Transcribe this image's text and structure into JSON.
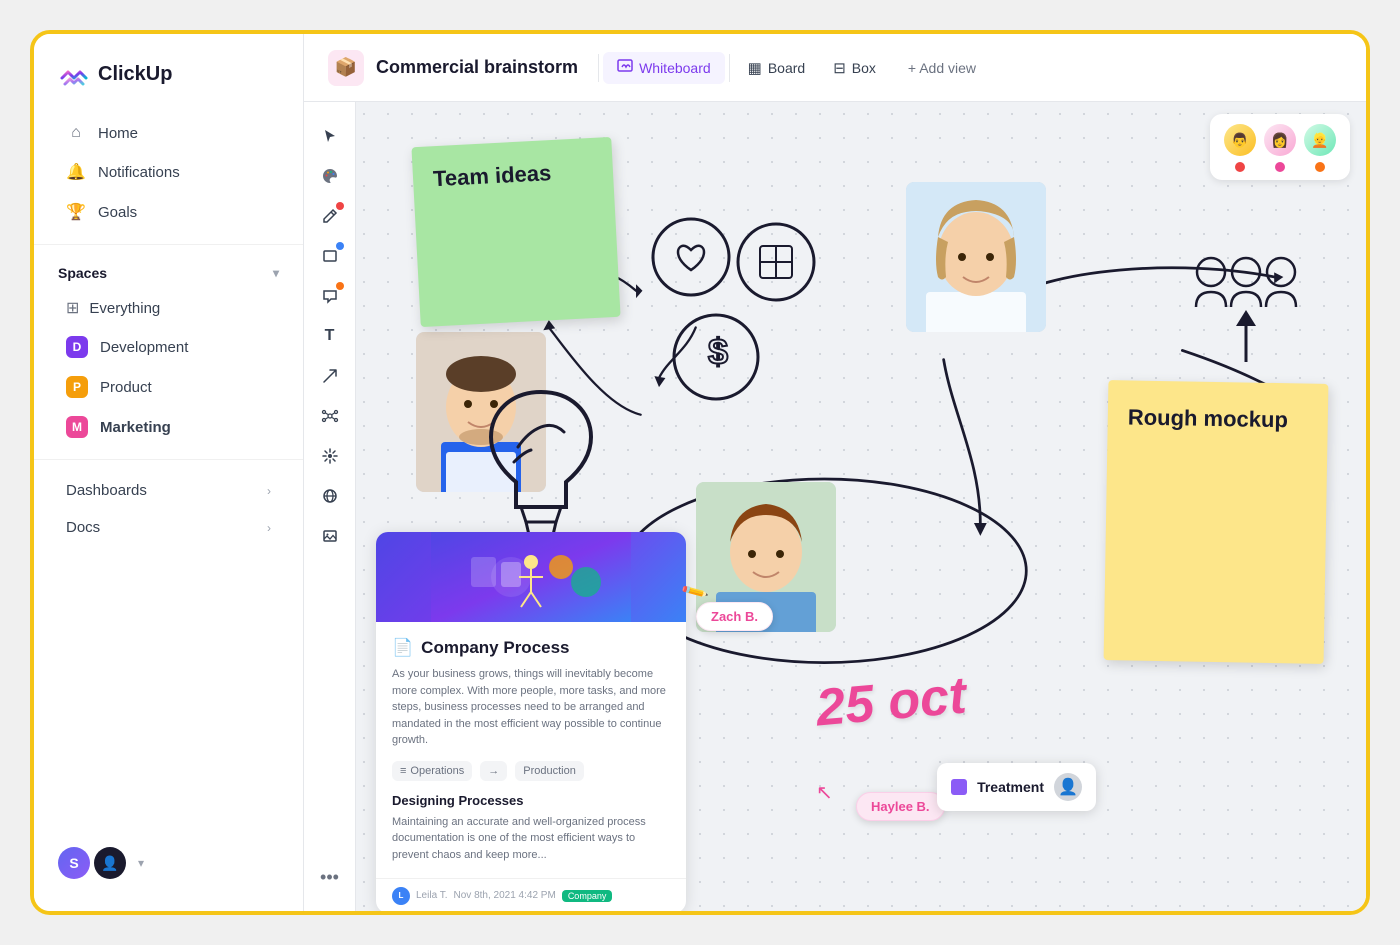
{
  "app": {
    "name": "ClickUp"
  },
  "sidebar": {
    "nav": [
      {
        "id": "home",
        "label": "Home",
        "icon": "🏠"
      },
      {
        "id": "notifications",
        "label": "Notifications",
        "icon": "🔔"
      },
      {
        "id": "goals",
        "label": "Goals",
        "icon": "🏆"
      }
    ],
    "spaces_label": "Spaces",
    "spaces": [
      {
        "id": "everything",
        "label": "Everything",
        "icon": "⊞"
      },
      {
        "id": "development",
        "label": "Development",
        "badge": "D",
        "color": "badge-d"
      },
      {
        "id": "product",
        "label": "Product",
        "badge": "P",
        "color": "badge-p"
      },
      {
        "id": "marketing",
        "label": "Marketing",
        "badge": "M",
        "color": "badge-m",
        "bold": true
      }
    ],
    "dashboards_label": "Dashboards",
    "docs_label": "Docs"
  },
  "header": {
    "doc_icon": "📦",
    "doc_title": "Commercial brainstorm",
    "tabs": [
      {
        "id": "whiteboard",
        "label": "Whiteboard",
        "icon": "✏️",
        "active": true
      },
      {
        "id": "board",
        "label": "Board",
        "icon": "⊞",
        "active": false
      },
      {
        "id": "box",
        "label": "Box",
        "icon": "⊟",
        "active": false
      }
    ],
    "add_view_label": "+ Add view"
  },
  "toolbar": {
    "tools": [
      {
        "id": "cursor",
        "icon": "↖",
        "dot": null
      },
      {
        "id": "palette",
        "icon": "🎨",
        "dot": null
      },
      {
        "id": "pencil",
        "icon": "✏️",
        "dot": "red"
      },
      {
        "id": "rectangle",
        "icon": "▭",
        "dot": "blue"
      },
      {
        "id": "comment",
        "icon": "💬",
        "dot": "orange"
      },
      {
        "id": "text",
        "icon": "T",
        "dot": null
      },
      {
        "id": "arrows",
        "icon": "↗",
        "dot": null
      },
      {
        "id": "network",
        "icon": "⑃",
        "dot": null
      },
      {
        "id": "sparkle",
        "icon": "✦",
        "dot": null
      },
      {
        "id": "globe",
        "icon": "🌐",
        "dot": null
      },
      {
        "id": "image",
        "icon": "🖼",
        "dot": null
      }
    ]
  },
  "canvas": {
    "sticky_green": {
      "text": "Team ideas"
    },
    "sticky_yellow": {
      "text": "Rough mockup"
    },
    "doc_card": {
      "title": "Company Process",
      "body": "As your business grows, things will inevitably become more complex. With more people, more tasks, and more steps, business processes need to be arranged and mandated in the most efficient way possible to continue growth.",
      "tags": [
        {
          "icon": "≡",
          "text": "Operations"
        },
        {
          "icon": "→",
          "text": "Production"
        }
      ],
      "subtitle": "Designing Processes",
      "body2": "Maintaining an accurate and well-organized process documentation is one of the most efficient ways to prevent chaos and keep more...",
      "footer_name": "Leila T.",
      "footer_date": "Nov 8th, 2021  4:42 PM",
      "footer_badge": "Company"
    },
    "name_labels": [
      {
        "text": "Zach B.",
        "class": "name-label-zach"
      },
      {
        "text": "Haylee B.",
        "class": "name-label-haylee"
      }
    ],
    "treatment_badge": {
      "label": "Treatment"
    },
    "handwritten_date": "25 oct",
    "collaborators": [
      {
        "initials": "👨",
        "dot": "dot-red"
      },
      {
        "initials": "👩",
        "dot": "dot-pink"
      },
      {
        "initials": "👱",
        "dot": "dot-orange"
      }
    ]
  },
  "footer": {
    "avatar_label": "S",
    "more_icon": "..."
  }
}
